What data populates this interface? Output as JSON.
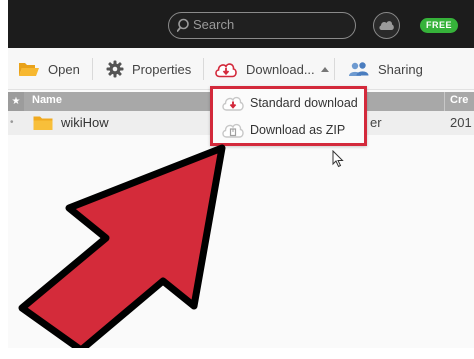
{
  "header": {
    "search_placeholder": "Search",
    "plan_badge": "FREE"
  },
  "toolbar": {
    "open_label": "Open",
    "properties_label": "Properties",
    "download_label": "Download...",
    "sharing_label": "Sharing"
  },
  "list": {
    "columns": [
      "Name",
      "Cre"
    ],
    "rows": [
      {
        "name": "wikiHow",
        "type": "er",
        "created": "201"
      }
    ]
  },
  "download_menu": {
    "items": [
      {
        "label": "Standard download",
        "icon": "download-cloud-icon"
      },
      {
        "label": "Download as ZIP",
        "icon": "zip-cloud-icon"
      }
    ]
  },
  "colors": {
    "accent_red": "#d3293b",
    "badge_green": "#36b23a",
    "topbar": "#1c1c1c"
  }
}
